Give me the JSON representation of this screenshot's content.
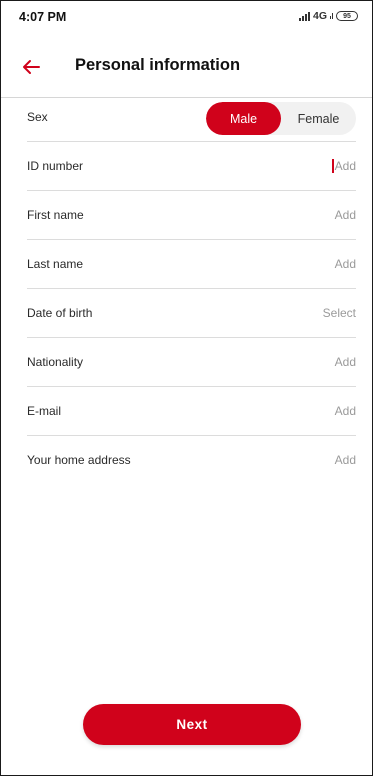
{
  "status_bar": {
    "time": "4:07 PM",
    "network": "4G",
    "battery": "95"
  },
  "header": {
    "title": "Personal information",
    "back_icon": "arrow-left-icon"
  },
  "form": {
    "sex": {
      "label": "Sex",
      "options": [
        "Male",
        "Female"
      ],
      "selected": "Male"
    },
    "fields": [
      {
        "label": "ID number",
        "value": "Add",
        "focused": true
      },
      {
        "label": "First name",
        "value": "Add"
      },
      {
        "label": "Last name",
        "value": "Add"
      },
      {
        "label": "Date of birth",
        "value": "Select"
      },
      {
        "label": "Nationality",
        "value": "Add"
      },
      {
        "label": "E-mail",
        "value": "Add"
      },
      {
        "label": "Your home address",
        "value": "Add"
      }
    ]
  },
  "footer": {
    "next_label": "Next"
  },
  "colors": {
    "accent": "#d0021b",
    "placeholder": "#9a9a9a",
    "divider": "#dcdcdc"
  }
}
